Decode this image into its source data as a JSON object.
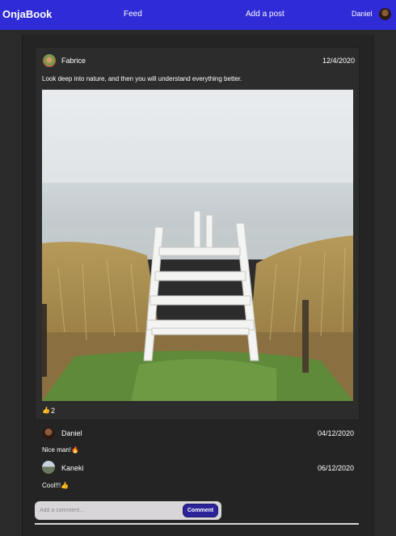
{
  "nav": {
    "logo": "OnjaBook",
    "feed": "Feed",
    "add_post": "Add a post",
    "user": "Daniel"
  },
  "post": {
    "author": "Fabrice",
    "date": "12/4/2020",
    "caption": "Look deep into nature, and then you will understand everything better.",
    "likes": "2",
    "like_icon": "thumbs-up-icon"
  },
  "comments": [
    {
      "author": "Daniel",
      "date": "04/12/2020",
      "text": "Nice man!🔥"
    },
    {
      "author": "Kaneki",
      "date": "06/12/2020",
      "text": "Cool!!!👍"
    }
  ],
  "comment_form": {
    "placeholder": "Add a comment...",
    "button": "Comment"
  },
  "colors": {
    "topbar": "#2f2bd6",
    "background": "#2b2a2b",
    "button": "#2b2498"
  }
}
